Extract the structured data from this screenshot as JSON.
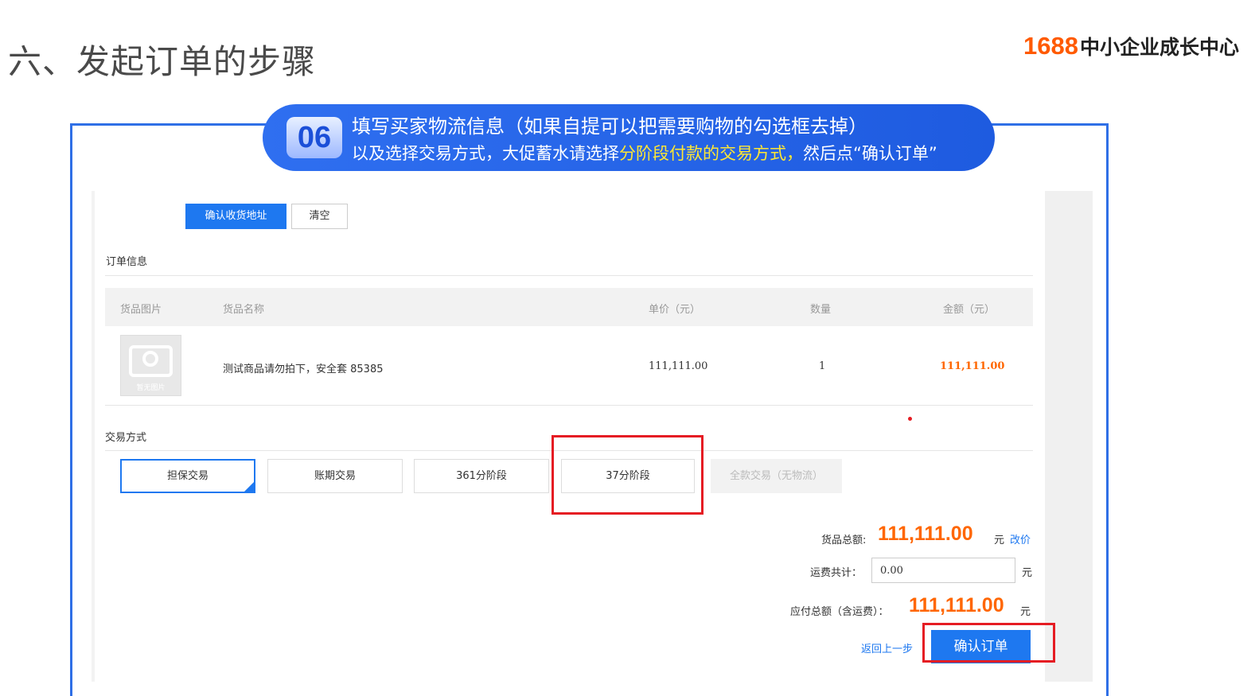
{
  "slide": {
    "title": "六、发起订单的步骤",
    "brand_num": "1688",
    "brand_text": "中小企业成长中心"
  },
  "banner": {
    "step": "06",
    "line1": "填写买家物流信息（如果自提可以把需要购物的勾选框去掉）",
    "line2_a": "以及选择交易方式，大促蓄水请选择",
    "line2_highlight": "分阶段付款的交易方式，",
    "line2_b": "然后点“确认订单”"
  },
  "address": {
    "confirm_label": "确认收货地址",
    "clear_label": "清空"
  },
  "order_info": {
    "section_title": "订单信息",
    "columns": [
      "货品图片",
      "货品名称",
      "单价（元）",
      "数量",
      "金额（元）"
    ],
    "rows": [
      {
        "image_caption": "暂无图片",
        "name": "测试商品请勿拍下，安全套 85385",
        "unit_price": "111,111.00",
        "qty": "1",
        "amount": "111,111.00"
      }
    ]
  },
  "trade": {
    "section_title": "交易方式",
    "options": [
      "担保交易",
      "账期交易",
      "361分阶段",
      "37分阶段",
      "全款交易（无物流）"
    ],
    "selected": "担保交易"
  },
  "summary": {
    "goods_total_label": "货品总额:",
    "goods_total_value": "111,111.00",
    "unit": "元",
    "change_price_label": "改价",
    "freight_label": "运费共计：",
    "freight_value": "0.00",
    "payable_label": "应付总额（含运费）：",
    "payable_value": "111,111.00",
    "back_label": "返回上一步",
    "confirm_order_label": "确认订单"
  },
  "colors": {
    "primary": "#1e78f0",
    "accent_orange": "#ff6600",
    "highlight_red": "#e51c23",
    "banner_blue": "#2f6ff0",
    "highlight_yellow": "#ffe733"
  }
}
